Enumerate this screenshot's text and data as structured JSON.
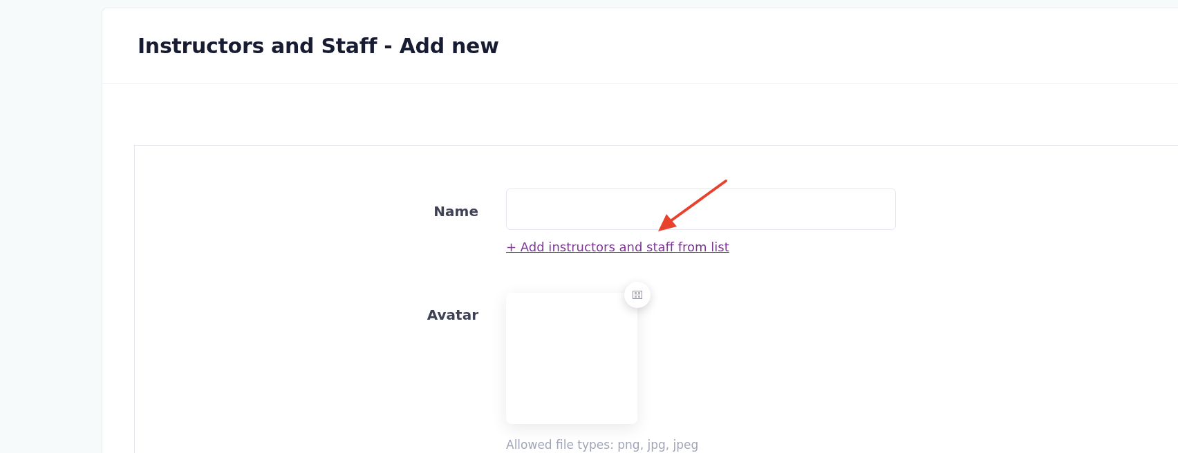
{
  "page": {
    "title": "Instructors and Staff - Add new"
  },
  "form": {
    "fields": [
      {
        "kind": "text",
        "label": "Name",
        "link": "+ Add instructors and staff from list"
      },
      {
        "kind": "avatar",
        "label": "Avatar",
        "hint": "Allowed file types: png, jpg, jpeg"
      }
    ]
  }
}
